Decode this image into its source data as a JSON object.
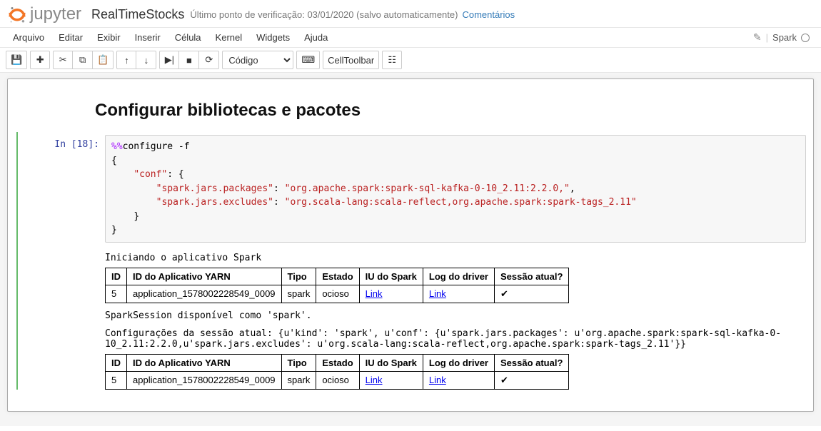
{
  "header": {
    "logo_text": "jupyter",
    "notebook_name": "RealTimeStocks",
    "checkpoint": "Último ponto de verificação: 03/01/2020 (salvo automaticamente)",
    "comments": "Comentários"
  },
  "menubar": {
    "items": [
      "Arquivo",
      "Editar",
      "Exibir",
      "Inserir",
      "Célula",
      "Kernel",
      "Widgets",
      "Ajuda"
    ],
    "kernel": "Spark"
  },
  "toolbar": {
    "save": "💾",
    "add": "✚",
    "cut": "✂",
    "copy": "⧉",
    "paste": "📋",
    "up": "↑",
    "down": "↓",
    "run": "▶|",
    "stop": "■",
    "restart": "⟳",
    "cell_type": "Código",
    "cmd": "⌨",
    "celltoolbar": "CellToolbar",
    "toggle": "☷"
  },
  "cells": {
    "md_heading": "Configurar bibliotecas e pacotes",
    "code": {
      "prompt": "In [18]:",
      "line1_magic": "%%",
      "line1_rest": "configure -f",
      "line2": "{",
      "line3_indent": "    ",
      "line3_key": "\"conf\"",
      "line3_after": ": {",
      "line4_indent": "        ",
      "line4_key": "\"spark.jars.packages\"",
      "line4_colon": ": ",
      "line4_val": "\"org.apache.spark:spark-sql-kafka-0-10_2.11:2.2.0,\"",
      "line4_comma": ",",
      "line5_indent": "        ",
      "line5_key": "\"spark.jars.excludes\"",
      "line5_colon": ": ",
      "line5_val": "\"org.scala-lang:scala-reflect,org.apache.spark:spark-tags_2.11\"",
      "line6_indent": "    ",
      "line6": "}",
      "line7": "}"
    },
    "output": {
      "starting": "Iniciando o aplicativo Spark",
      "table_headers": [
        "ID",
        "ID do Aplicativo YARN",
        "Tipo",
        "Estado",
        "IU do Spark",
        "Log do driver",
        "Sessão atual?"
      ],
      "table_row": {
        "id": "5",
        "app_id": "application_1578002228549_0009",
        "type": "spark",
        "state": "ocioso",
        "spark_ui": "Link",
        "driver_log": "Link",
        "current": "✔"
      },
      "session_avail": "SparkSession disponível como 'spark'.",
      "config_prefix": "Configurações da sessão atual:",
      "config_body": " {u'kind': 'spark', u'conf': {u'spark.jars.packages': u'org.apache.spark:spark-sql-kafka-0-10_2.11:2.2.0,u'spark.jars.excludes': u'org.scala-lang:scala-reflect,org.apache.spark:spark-tags_2.11'}}"
    }
  }
}
